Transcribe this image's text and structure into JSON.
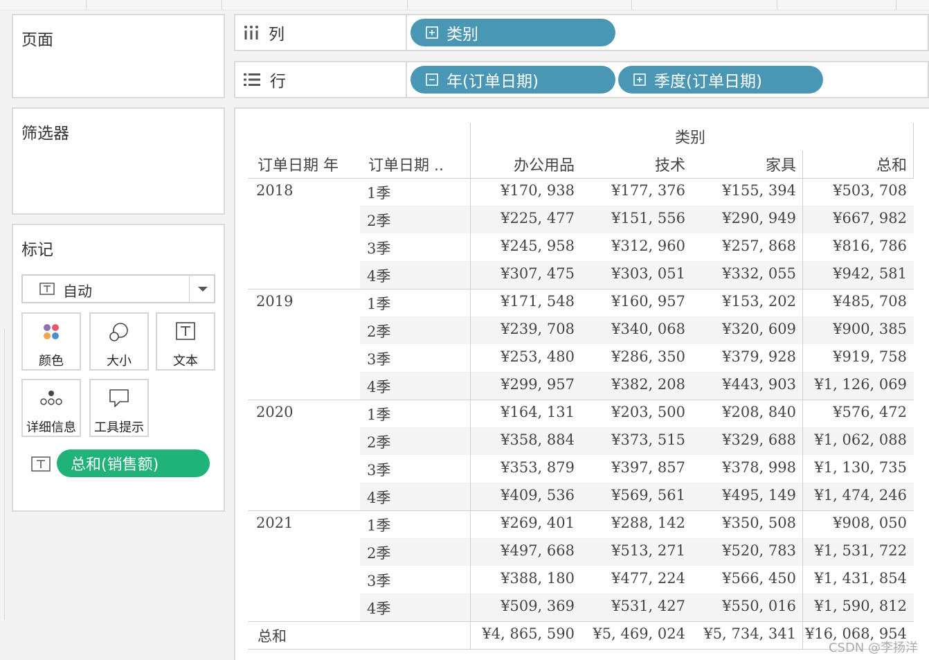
{
  "panels": {
    "pages": "页面",
    "filters": "筛选器",
    "marks": {
      "title": "标记",
      "type": "自动",
      "buttons": [
        {
          "label": "颜色",
          "icon": "color-dots-icon"
        },
        {
          "label": "大小",
          "icon": "size-circles-icon"
        },
        {
          "label": "文本",
          "icon": "text-t-icon"
        },
        {
          "label": "详细信息",
          "icon": "detail-dots-icon"
        },
        {
          "label": "工具提示",
          "icon": "tooltip-speech-icon"
        }
      ],
      "field_pill": "总和(销售额)"
    }
  },
  "shelves": {
    "columns": {
      "label": "列",
      "pills": [
        "类别"
      ]
    },
    "rows": {
      "label": "行",
      "pills": [
        "年(订单日期)",
        "季度(订单日期)"
      ]
    }
  },
  "table": {
    "column_group_title": "类别",
    "row_headers": [
      "订单日期 年",
      "订单日期 .."
    ],
    "columns": [
      "办公用品",
      "技术",
      "家具",
      "总和"
    ],
    "groups": [
      {
        "year": "2018",
        "rows": [
          {
            "q": "1季",
            "v": [
              "¥170, 938",
              "¥177, 376",
              "¥155, 394",
              "¥503, 708"
            ]
          },
          {
            "q": "2季",
            "v": [
              "¥225, 477",
              "¥151, 556",
              "¥290, 949",
              "¥667, 982"
            ]
          },
          {
            "q": "3季",
            "v": [
              "¥245, 958",
              "¥312, 960",
              "¥257, 868",
              "¥816, 786"
            ]
          },
          {
            "q": "4季",
            "v": [
              "¥307, 475",
              "¥303, 051",
              "¥332, 055",
              "¥942, 581"
            ]
          }
        ]
      },
      {
        "year": "2019",
        "rows": [
          {
            "q": "1季",
            "v": [
              "¥171, 548",
              "¥160, 957",
              "¥153, 202",
              "¥485, 708"
            ]
          },
          {
            "q": "2季",
            "v": [
              "¥239, 708",
              "¥340, 068",
              "¥320, 609",
              "¥900, 385"
            ]
          },
          {
            "q": "3季",
            "v": [
              "¥253, 480",
              "¥286, 350",
              "¥379, 928",
              "¥919, 758"
            ]
          },
          {
            "q": "4季",
            "v": [
              "¥299, 957",
              "¥382, 208",
              "¥443, 903",
              "¥1, 126, 069"
            ]
          }
        ]
      },
      {
        "year": "2020",
        "rows": [
          {
            "q": "1季",
            "v": [
              "¥164, 131",
              "¥203, 500",
              "¥208, 840",
              "¥576, 472"
            ]
          },
          {
            "q": "2季",
            "v": [
              "¥358, 884",
              "¥373, 515",
              "¥329, 688",
              "¥1, 062, 088"
            ]
          },
          {
            "q": "3季",
            "v": [
              "¥353, 879",
              "¥397, 857",
              "¥378, 998",
              "¥1, 130, 735"
            ]
          },
          {
            "q": "4季",
            "v": [
              "¥409, 536",
              "¥569, 561",
              "¥495, 149",
              "¥1, 474, 246"
            ]
          }
        ]
      },
      {
        "year": "2021",
        "rows": [
          {
            "q": "1季",
            "v": [
              "¥269, 401",
              "¥288, 142",
              "¥350, 508",
              "¥908, 050"
            ]
          },
          {
            "q": "2季",
            "v": [
              "¥497, 668",
              "¥513, 271",
              "¥520, 783",
              "¥1, 531, 722"
            ]
          },
          {
            "q": "3季",
            "v": [
              "¥388, 180",
              "¥477, 224",
              "¥566, 450",
              "¥1, 431, 854"
            ]
          },
          {
            "q": "4季",
            "v": [
              "¥509, 369",
              "¥531, 427",
              "¥550, 016",
              "¥1, 590, 812"
            ]
          }
        ]
      }
    ],
    "grand_total": {
      "label": "总和",
      "v": [
        "¥4, 865, 590",
        "¥5, 469, 024",
        "¥5, 734, 341",
        "¥16, 068, 954"
      ]
    }
  },
  "watermark": "CSDN @李扬洋",
  "colors": {
    "shelf_pill": "#4a97b5",
    "measure_pill": "#1fb37a"
  }
}
